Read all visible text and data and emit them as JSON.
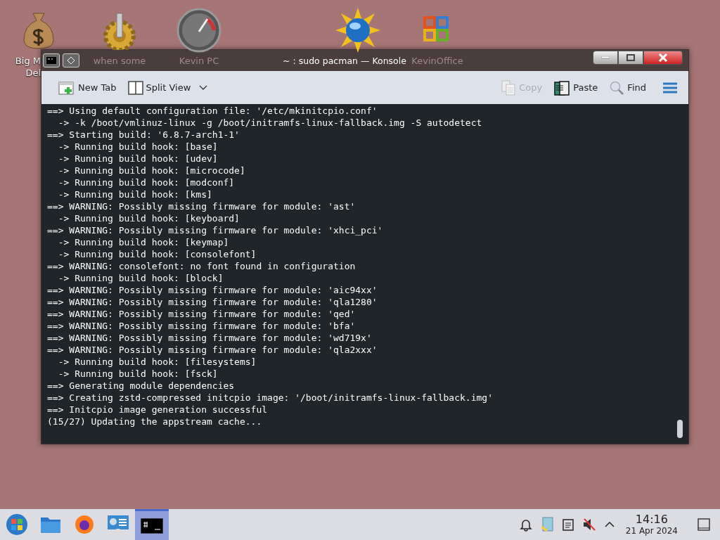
{
  "desktop": {
    "icons": [
      {
        "kind": "money",
        "label_lines": [
          "Big M",
          "Del"
        ]
      },
      {
        "kind": "gear",
        "label_lines": [
          "when some"
        ]
      },
      {
        "kind": "gauge",
        "label_lines": [
          "Kevin PC"
        ]
      },
      {
        "kind": "globe"
      },
      {
        "kind": "office",
        "label_lines": [
          "KevinOffice"
        ]
      }
    ]
  },
  "window": {
    "title": "~ : sudo pacman — Konsole",
    "toolbar": [
      {
        "kind": "newtab",
        "label": "New Tab",
        "disabled": false
      },
      {
        "kind": "split",
        "label": "Split View",
        "disabled": false
      },
      {
        "kind": "copy",
        "label": "Copy",
        "disabled": true
      },
      {
        "kind": "paste",
        "label": "Paste",
        "disabled": false
      },
      {
        "kind": "find",
        "label": "Find",
        "disabled": false
      }
    ],
    "terminal_lines": [
      "==> Using default configuration file: '/etc/mkinitcpio.conf'",
      "  -> -k /boot/vmlinuz-linux -g /boot/initramfs-linux-fallback.img -S autodetect",
      "==> Starting build: '6.8.7-arch1-1'",
      "  -> Running build hook: [base]",
      "  -> Running build hook: [udev]",
      "  -> Running build hook: [microcode]",
      "  -> Running build hook: [modconf]",
      "  -> Running build hook: [kms]",
      "==> WARNING: Possibly missing firmware for module: 'ast'",
      "  -> Running build hook: [keyboard]",
      "==> WARNING: Possibly missing firmware for module: 'xhci_pci'",
      "  -> Running build hook: [keymap]",
      "  -> Running build hook: [consolefont]",
      "==> WARNING: consolefont: no font found in configuration",
      "  -> Running build hook: [block]",
      "==> WARNING: Possibly missing firmware for module: 'aic94xx'",
      "==> WARNING: Possibly missing firmware for module: 'qla1280'",
      "==> WARNING: Possibly missing firmware for module: 'qed'",
      "==> WARNING: Possibly missing firmware for module: 'bfa'",
      "==> WARNING: Possibly missing firmware for module: 'wd719x'",
      "==> WARNING: Possibly missing firmware for module: 'qla2xxx'",
      "  -> Running build hook: [filesystems]",
      "  -> Running build hook: [fsck]",
      "==> Generating module dependencies",
      "==> Creating zstd-compressed initcpio image: '/boot/initramfs-linux-fallback.img'",
      "==> Initcpio image generation successful",
      "(15/27) Updating the appstream cache..."
    ]
  },
  "taskbar": {
    "items": [
      {
        "kind": "start",
        "selected": false
      },
      {
        "kind": "files",
        "selected": false
      },
      {
        "kind": "browser",
        "selected": false
      },
      {
        "kind": "settings",
        "selected": false
      },
      {
        "kind": "terminal",
        "selected": true
      }
    ],
    "tray": [
      {
        "kind": "bell"
      },
      {
        "kind": "clipboard-app"
      },
      {
        "kind": "notes"
      },
      {
        "kind": "mute"
      },
      {
        "kind": "expand"
      }
    ],
    "time": "14:16",
    "date": "21 Apr 2024"
  }
}
